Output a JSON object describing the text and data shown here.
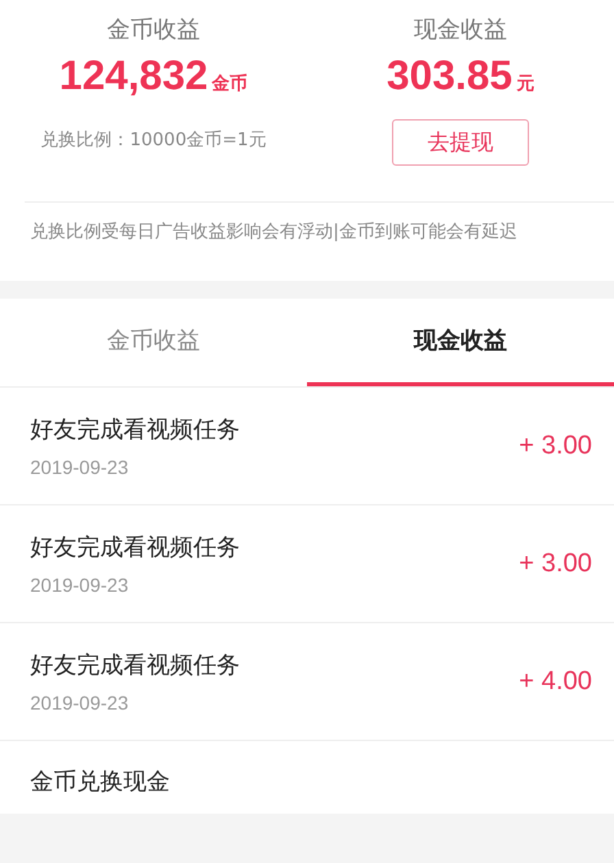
{
  "summary": [
    {
      "title": "金币收益",
      "amount": "124,832",
      "unit": "金币"
    },
    {
      "title": "现金收益",
      "amount": "303.85",
      "unit": "元"
    }
  ],
  "exchange_rate": "兑换比例：10000金币=1元",
  "withdraw_button": "去提现",
  "notice": "兑换比例受每日广告收益影响会有浮动|金币到账可能会有延迟",
  "tabs": [
    {
      "label": "金币收益",
      "selected": false
    },
    {
      "label": "现金收益",
      "selected": true
    }
  ],
  "records": [
    {
      "title": "好友完成看视频任务",
      "date": "2019-09-23",
      "amount": "+ 3.00"
    },
    {
      "title": "好友完成看视频任务",
      "date": "2019-09-23",
      "amount": "+ 3.00"
    },
    {
      "title": "好友完成看视频任务",
      "date": "2019-09-23",
      "amount": "+ 4.00"
    },
    {
      "title": "金币兑换现金"
    }
  ]
}
